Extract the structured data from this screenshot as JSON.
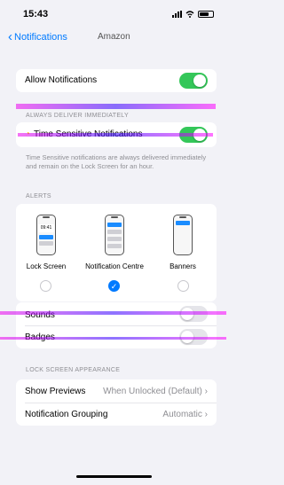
{
  "status_bar": {
    "time": "15:43"
  },
  "nav": {
    "back_label": "Notifications",
    "title": "Amazon"
  },
  "allow": {
    "label": "Allow Notifications",
    "enabled": true
  },
  "deliver_section": {
    "header": "ALWAYS DELIVER IMMEDIATELY",
    "label": "Time Sensitive Notifications",
    "enabled": true
  },
  "time_sensitive_footnote": "Time Sensitive notifications are always delivered immediately and remain on the Lock Screen for an hour.",
  "alerts_section": {
    "header": "ALERTS",
    "lock_time": "09:41",
    "options": [
      {
        "label": "Lock Screen",
        "checked": false
      },
      {
        "label": "Notification Centre",
        "checked": true
      },
      {
        "label": "Banners",
        "checked": false
      }
    ]
  },
  "sounds": {
    "label": "Sounds",
    "enabled": false
  },
  "badges": {
    "label": "Badges",
    "enabled": false
  },
  "lock_section": {
    "header": "LOCK SCREEN APPEARANCE",
    "show_previews": {
      "label": "Show Previews",
      "value": "When Unlocked (Default)"
    },
    "grouping": {
      "label": "Notification Grouping",
      "value": "Automatic"
    }
  },
  "icons": {
    "back": "chevron-left-icon",
    "bell": "bell-icon",
    "check": "checkmark-icon",
    "disclosure": "chevron-right-icon"
  },
  "colors": {
    "accent": "#007aff",
    "toggle_on": "#34c759",
    "background": "#f2f2f7"
  }
}
